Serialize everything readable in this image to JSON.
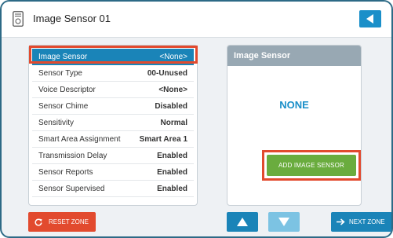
{
  "header": {
    "title": "Image Sensor 01",
    "device_icon": "sensor-device-icon",
    "back_icon": "back-arrow-icon"
  },
  "settings_list": [
    {
      "label": "Image Sensor",
      "value": "<None>",
      "selected": true
    },
    {
      "label": "Sensor Type",
      "value": "00-Unused"
    },
    {
      "label": "Voice Descriptor",
      "value": "<None>"
    },
    {
      "label": "Sensor Chime",
      "value": "Disabled"
    },
    {
      "label": "Sensitivity",
      "value": "Normal"
    },
    {
      "label": "Smart Area Assignment",
      "value": "Smart Area 1"
    },
    {
      "label": "Transmission Delay",
      "value": "Enabled"
    },
    {
      "label": "Sensor Reports",
      "value": "Enabled"
    },
    {
      "label": "Sensor Supervised",
      "value": "Enabled"
    }
  ],
  "detail": {
    "title": "Image Sensor",
    "value": "NONE",
    "add_button": "ADD IMAGE SENSOR"
  },
  "footer": {
    "reset_label": "RESET ZONE",
    "reset_icon": "refresh-icon",
    "up_icon": "triangle-up-icon",
    "down_icon": "triangle-down-icon",
    "next_label": "NEXT ZONE",
    "next_icon": "arrow-right-icon"
  },
  "colors": {
    "accent_blue": "#1a84b8",
    "light_blue": "#7cc3e3",
    "green": "#6aac3e",
    "red": "#e24a2e",
    "panel_header_gray": "#98a8b3"
  }
}
